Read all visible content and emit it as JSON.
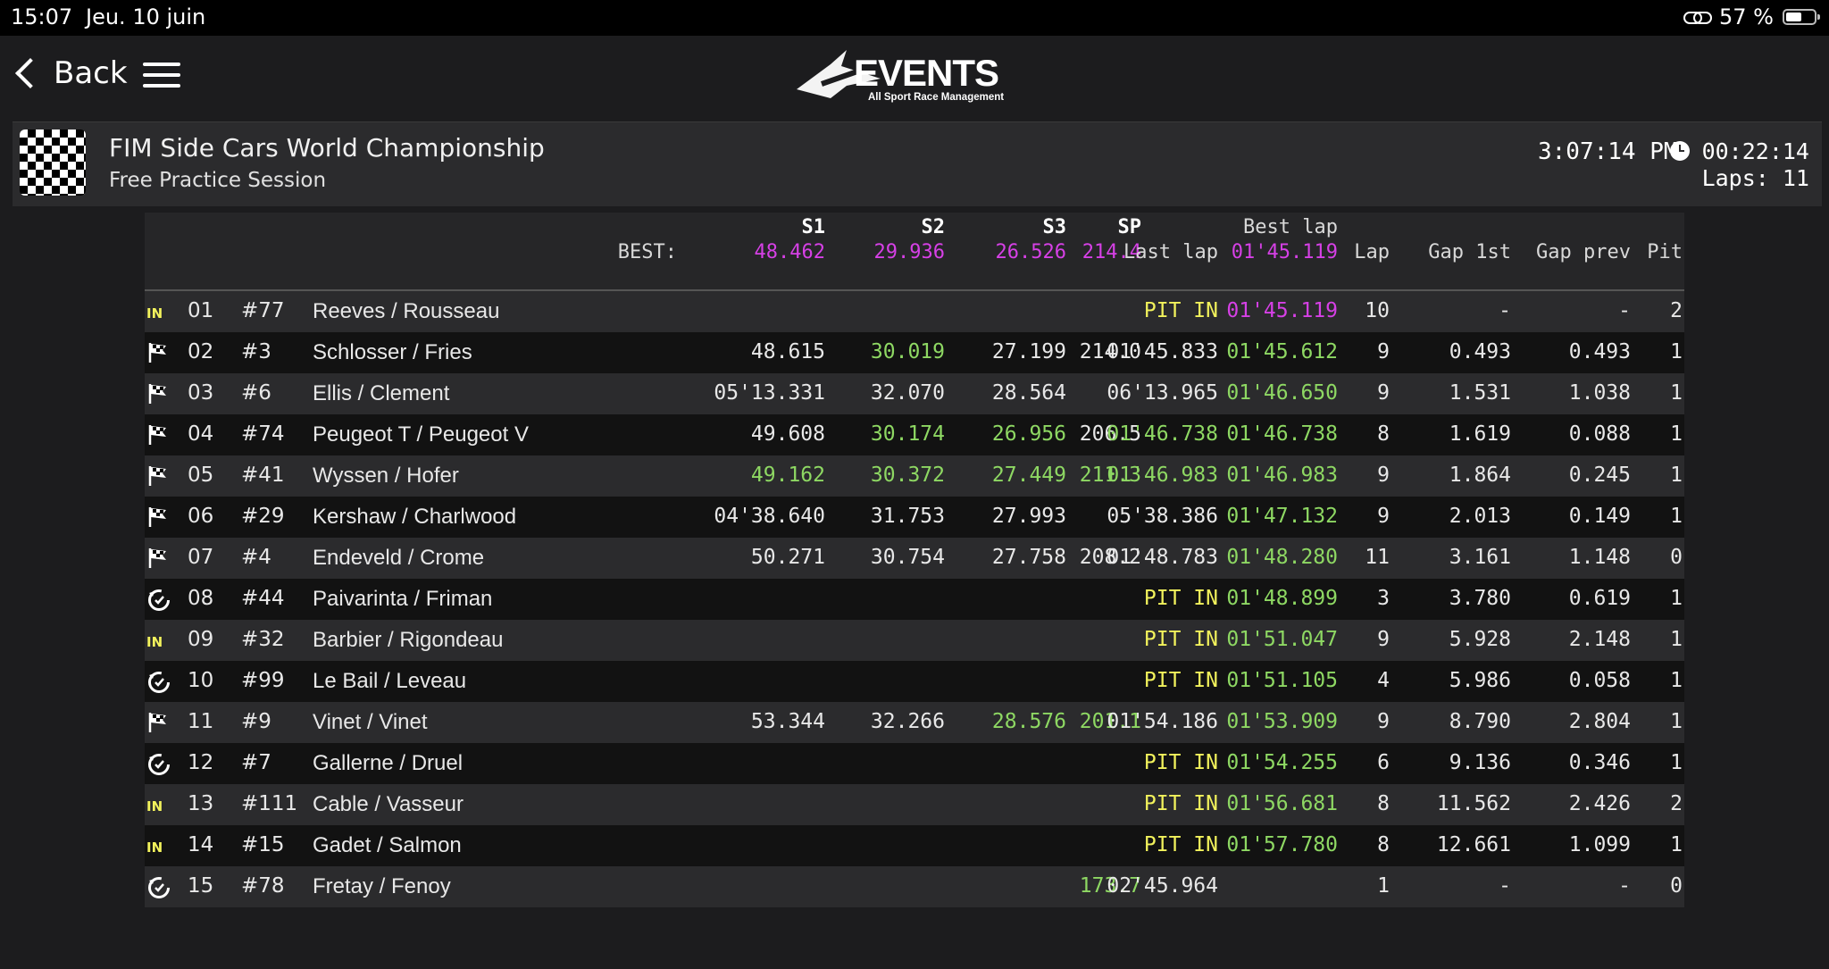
{
  "status_bar": {
    "time": "15:07",
    "date": "Jeu. 10 juin",
    "battery": "57 %",
    "battery_level": 0.57
  },
  "nav": {
    "back_label": "Back",
    "logo_text": "EVENTS",
    "logo_tagline": "All Sport Race Management"
  },
  "session": {
    "title": "FIM Side Cars World Championship",
    "subtitle": "Free Practice Session",
    "clock": "3:07:14 PM",
    "elapsed": "00:22:14",
    "laps": "Laps: 11"
  },
  "colors": {
    "session_best": "#d640e6",
    "personal_best": "#8ed863",
    "pit": "#f2f25c"
  },
  "header": {
    "best_label": "BEST:",
    "s1": "S1",
    "s2": "S2",
    "s3": "S3",
    "sp": "SP",
    "best_s1": "48.462",
    "best_s2": "29.936",
    "best_s3": "26.526",
    "best_sp": "214.4",
    "last_lap": "Last lap",
    "best_lap": "Best lap",
    "best_lap_value": "01'45.119",
    "lap": "Lap",
    "gap_1st": "Gap 1st",
    "gap_prev": "Gap prev",
    "pit": "Pit"
  },
  "rows": [
    {
      "icon": "pit-in",
      "pos": "01",
      "num": "#77",
      "name": "Reeves / Rousseau",
      "s1": "",
      "s2": "",
      "s3": "",
      "sp": "",
      "last": "PIT IN",
      "best": "01'45.119",
      "lap": "10",
      "gap1": "-",
      "gapp": "-",
      "pit": "2",
      "c_last": "yel",
      "c_best": "mag"
    },
    {
      "icon": "flag",
      "pos": "02",
      "num": "#3",
      "name": "Schlosser / Fries",
      "s1": "48.615",
      "s2": "30.019",
      "s3": "27.199",
      "sp": "214.0",
      "last": "01'45.833",
      "best": "01'45.612",
      "lap": "9",
      "gap1": "0.493",
      "gapp": "0.493",
      "pit": "1",
      "c_s2": "grn",
      "c_best": "grn"
    },
    {
      "icon": "flag",
      "pos": "03",
      "num": "#6",
      "name": "Ellis / Clement",
      "s1": "05'13.331",
      "s2": "32.070",
      "s3": "28.564",
      "sp": "",
      "last": "06'13.965",
      "best": "01'46.650",
      "lap": "9",
      "gap1": "1.531",
      "gapp": "1.038",
      "pit": "1",
      "c_best": "grn"
    },
    {
      "icon": "flag",
      "pos": "04",
      "num": "#74",
      "name": "Peugeot T / Peugeot V",
      "s1": "49.608",
      "s2": "30.174",
      "s3": "26.956",
      "sp": "206.5",
      "last": "01'46.738",
      "best": "01'46.738",
      "lap": "8",
      "gap1": "1.619",
      "gapp": "0.088",
      "pit": "1",
      "c_s2": "grn",
      "c_s3": "grn",
      "c_last": "grn",
      "c_best": "grn"
    },
    {
      "icon": "flag",
      "pos": "05",
      "num": "#41",
      "name": "Wyssen / Hofer",
      "s1": "49.162",
      "s2": "30.372",
      "s3": "27.449",
      "sp": "211.3",
      "last": "01'46.983",
      "best": "01'46.983",
      "lap": "9",
      "gap1": "1.864",
      "gapp": "0.245",
      "pit": "1",
      "c_s1": "grn",
      "c_s2": "grn",
      "c_s3": "grn",
      "c_sp": "grn",
      "c_last": "grn",
      "c_best": "grn"
    },
    {
      "icon": "flag",
      "pos": "06",
      "num": "#29",
      "name": "Kershaw / Charlwood",
      "s1": "04'38.640",
      "s2": "31.753",
      "s3": "27.993",
      "sp": "",
      "last": "05'38.386",
      "best": "01'47.132",
      "lap": "9",
      "gap1": "2.013",
      "gapp": "0.149",
      "pit": "1",
      "c_best": "grn"
    },
    {
      "icon": "flag",
      "pos": "07",
      "num": "#4",
      "name": "Endeveld / Crome",
      "s1": "50.271",
      "s2": "30.754",
      "s3": "27.758",
      "sp": "208.2",
      "last": "01'48.783",
      "best": "01'48.280",
      "lap": "11",
      "gap1": "3.161",
      "gapp": "1.148",
      "pit": "0",
      "c_best": "grn"
    },
    {
      "icon": "pit-out",
      "pos": "08",
      "num": "#44",
      "name": "Paivarinta / Friman",
      "s1": "",
      "s2": "",
      "s3": "",
      "sp": "",
      "last": "PIT IN",
      "best": "01'48.899",
      "lap": "3",
      "gap1": "3.780",
      "gapp": "0.619",
      "pit": "1",
      "c_last": "yel",
      "c_best": "grn"
    },
    {
      "icon": "pit-in",
      "pos": "09",
      "num": "#32",
      "name": "Barbier / Rigondeau",
      "s1": "",
      "s2": "",
      "s3": "",
      "sp": "",
      "last": "PIT IN",
      "best": "01'51.047",
      "lap": "9",
      "gap1": "5.928",
      "gapp": "2.148",
      "pit": "1",
      "c_last": "yel",
      "c_best": "grn"
    },
    {
      "icon": "pit-out",
      "pos": "10",
      "num": "#99",
      "name": "Le Bail / Leveau",
      "s1": "",
      "s2": "",
      "s3": "",
      "sp": "",
      "last": "PIT IN",
      "best": "01'51.105",
      "lap": "4",
      "gap1": "5.986",
      "gapp": "0.058",
      "pit": "1",
      "c_last": "yel",
      "c_best": "grn"
    },
    {
      "icon": "flag",
      "pos": "11",
      "num": "#9",
      "name": "Vinet / Vinet",
      "s1": "53.344",
      "s2": "32.266",
      "s3": "28.576",
      "sp": "201.1",
      "last": "01'54.186",
      "best": "01'53.909",
      "lap": "9",
      "gap1": "8.790",
      "gapp": "2.804",
      "pit": "1",
      "c_s3": "grn",
      "c_sp": "grn",
      "c_best": "grn"
    },
    {
      "icon": "pit-out",
      "pos": "12",
      "num": "#7",
      "name": "Gallerne / Druel",
      "s1": "",
      "s2": "",
      "s3": "",
      "sp": "",
      "last": "PIT IN",
      "best": "01'54.255",
      "lap": "6",
      "gap1": "9.136",
      "gapp": "0.346",
      "pit": "1",
      "c_last": "yel",
      "c_best": "grn"
    },
    {
      "icon": "pit-in",
      "pos": "13",
      "num": "#111",
      "name": "Cable / Vasseur",
      "s1": "",
      "s2": "",
      "s3": "",
      "sp": "",
      "last": "PIT IN",
      "best": "01'56.681",
      "lap": "8",
      "gap1": "11.562",
      "gapp": "2.426",
      "pit": "2",
      "c_last": "yel",
      "c_best": "grn"
    },
    {
      "icon": "pit-in",
      "pos": "14",
      "num": "#15",
      "name": "Gadet / Salmon",
      "s1": "",
      "s2": "",
      "s3": "",
      "sp": "",
      "last": "PIT IN",
      "best": "01'57.780",
      "lap": "8",
      "gap1": "12.661",
      "gapp": "1.099",
      "pit": "1",
      "c_last": "yel",
      "c_best": "grn"
    },
    {
      "icon": "pit-out",
      "pos": "15",
      "num": "#78",
      "name": "Fretay / Fenoy",
      "s1": "",
      "s2": "",
      "s3": "",
      "sp": "173.7",
      "last": "02'45.964",
      "best": "",
      "lap": "1",
      "gap1": "-",
      "gapp": "-",
      "pit": "0",
      "c_sp": "grn"
    }
  ]
}
